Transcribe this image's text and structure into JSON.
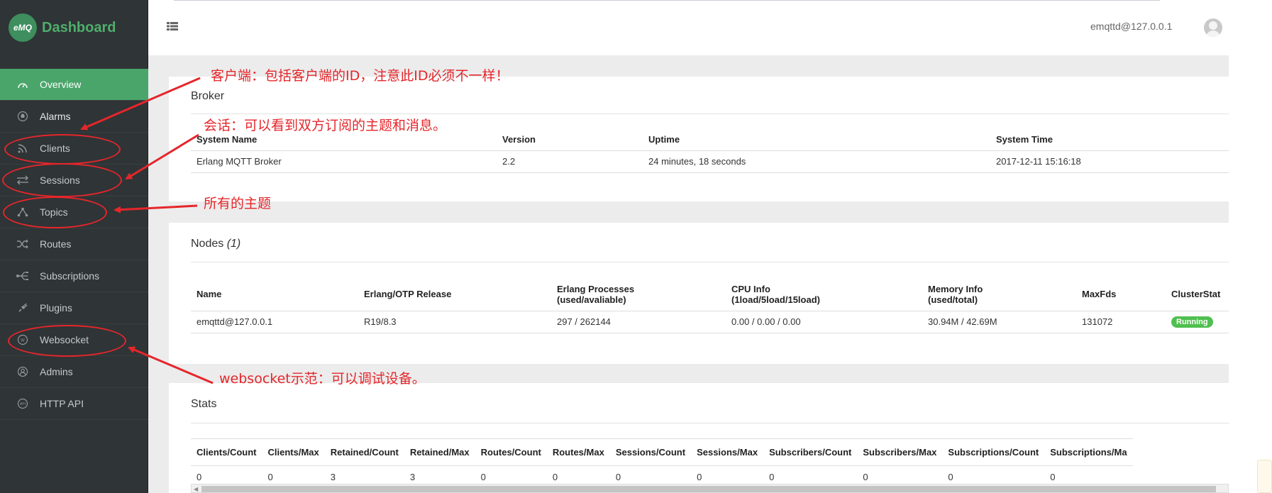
{
  "brand": {
    "logo_text": "eMQ",
    "title": "Dashboard"
  },
  "header": {
    "user": "emqttd@127.0.0.1"
  },
  "sidebar": {
    "items": [
      {
        "label": "Overview",
        "icon": "gauge-icon"
      },
      {
        "label": "Alarms",
        "icon": "bell-icon"
      },
      {
        "label": "Clients",
        "icon": "rss-icon"
      },
      {
        "label": "Sessions",
        "icon": "exchange-icon"
      },
      {
        "label": "Topics",
        "icon": "topic-tree-icon"
      },
      {
        "label": "Routes",
        "icon": "random-icon"
      },
      {
        "label": "Subscriptions",
        "icon": "share-icon"
      },
      {
        "label": "Plugins",
        "icon": "plug-icon"
      },
      {
        "label": "Websocket",
        "icon": "websocket-icon"
      },
      {
        "label": "Admins",
        "icon": "user-icon"
      },
      {
        "label": "HTTP API",
        "icon": "api-icon"
      }
    ]
  },
  "broker": {
    "title": "Broker",
    "headers": [
      "System Name",
      "Version",
      "Uptime",
      "System Time"
    ],
    "row": [
      "Erlang MQTT Broker",
      "2.2",
      "24 minutes, 18 seconds",
      "2017-12-11 15:16:18"
    ]
  },
  "nodes": {
    "title": "Nodes",
    "count": "(1)",
    "headers": [
      {
        "line1": "Name",
        "line2": ""
      },
      {
        "line1": "Erlang/OTP Release",
        "line2": ""
      },
      {
        "line1": "Erlang Processes",
        "line2": "(used/avaliable)"
      },
      {
        "line1": "CPU Info",
        "line2": "(1load/5load/15load)"
      },
      {
        "line1": "Memory Info",
        "line2": "(used/total)"
      },
      {
        "line1": "MaxFds",
        "line2": ""
      },
      {
        "line1": "ClusterStat",
        "line2": ""
      }
    ],
    "row": [
      "emqttd@127.0.0.1",
      "R19/8.3",
      "297 / 262144",
      "0.00 / 0.00 / 0.00",
      "30.94M / 42.69M",
      "131072",
      "Running"
    ]
  },
  "stats": {
    "title": "Stats",
    "headers": [
      "Clients/Count",
      "Clients/Max",
      "Retained/Count",
      "Retained/Max",
      "Routes/Count",
      "Routes/Max",
      "Sessions/Count",
      "Sessions/Max",
      "Subscribers/Count",
      "Subscribers/Max",
      "Subscriptions/Count",
      "Subscriptions/Ma"
    ],
    "row": [
      "0",
      "0",
      "3",
      "3",
      "0",
      "0",
      "0",
      "0",
      "0",
      "0",
      "0",
      "0"
    ]
  },
  "annotations": {
    "clients": "客户端：包括客户端的ID，注意此ID必须不一样！",
    "sessions": "会话：可以看到双方订阅的主题和消息。",
    "topics": "所有的主题",
    "websocket": "websocket示范：可以调试设备。"
  },
  "colors": {
    "sidebar_bg": "#2f3436",
    "active_green": "#4aa56b",
    "annotation_red": "#e5262b",
    "running_badge": "#4fbf4f"
  }
}
